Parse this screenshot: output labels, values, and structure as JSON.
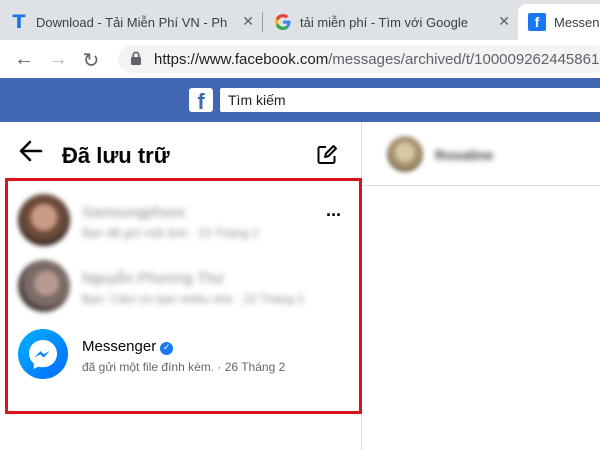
{
  "browser": {
    "tabs": [
      {
        "icon": "t-logo-icon",
        "title": "Download - Tải Miễn Phí VN - Ph",
        "close": "✕"
      },
      {
        "icon": "google-icon",
        "title": "tải miễn phí - Tìm với Google",
        "close": "✕"
      },
      {
        "icon": "facebook-icon",
        "title": "Messeng",
        "close": ""
      }
    ],
    "url_host": "https://www.facebook.com",
    "url_path": "/messages/archived/t/100009262445861"
  },
  "facebook": {
    "logo": "f",
    "search_placeholder": "Tìm kiếm"
  },
  "archived": {
    "title": "Đã lưu trữ",
    "conversations": [
      {
        "name": "Samsungphuoc",
        "subtitle": "Bạn đã gửi một ảnh · 23 Tháng 2",
        "blurred": true
      },
      {
        "name": "Nguyễn Phương Thư",
        "subtitle": "Bạn: Cảm ơn bạn nhiều nhé · 22 Tháng 2",
        "blurred": true
      },
      {
        "name": "Messenger",
        "subtitle": "đã gửi một file đính kèm. · 26 Tháng 2",
        "verified": true,
        "blurred": false
      }
    ],
    "more_label": "···",
    "highlight_color": "#d9141c"
  },
  "chat": {
    "contact_name": "Rosaline"
  },
  "colors": {
    "facebook_blue": "#4267b2",
    "messenger_blue": "#0084ff"
  }
}
